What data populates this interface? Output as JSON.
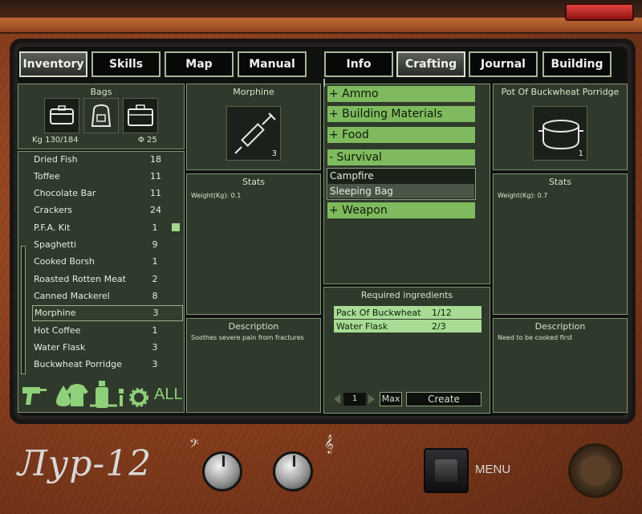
{
  "tabs": [
    {
      "label": "Inventory",
      "active": true
    },
    {
      "label": "Skills"
    },
    {
      "label": "Map"
    },
    {
      "label": "Manual"
    },
    {
      "label": "Info"
    },
    {
      "label": "Crafting",
      "active": true
    },
    {
      "label": "Journal"
    },
    {
      "label": "Building"
    }
  ],
  "bags": {
    "title": "Bags",
    "icons": [
      "box-icon",
      "backpack-icon",
      "suitcase-icon"
    ],
    "weight": "Kg 130/184",
    "count": "Φ 25"
  },
  "inventory": [
    {
      "name": "Dried Fish",
      "qty": "18"
    },
    {
      "name": "Toffee",
      "qty": "11"
    },
    {
      "name": "Chocolate Bar",
      "qty": "11"
    },
    {
      "name": "Crackers",
      "qty": "24"
    },
    {
      "name": "P.F.A. Kit",
      "qty": "1"
    },
    {
      "name": "Spaghetti",
      "qty": "9"
    },
    {
      "name": "Cooked Borsh",
      "qty": "1"
    },
    {
      "name": "Roasted Rotten Meat",
      "qty": "2"
    },
    {
      "name": "Canned Mackerel",
      "qty": "8"
    },
    {
      "name": "Morphine",
      "qty": "3"
    },
    {
      "name": "Hot Coffee",
      "qty": "1"
    },
    {
      "name": "Water Flask",
      "qty": "3"
    },
    {
      "name": "Buckwheat Porridge",
      "qty": "3"
    }
  ],
  "filter": {
    "all_label": "ALL",
    "icons": [
      "drill-icon",
      "drop-icon",
      "shirt-icon",
      "bottle-icon",
      "gear-icon",
      "syringe-icon",
      "tool-icon"
    ]
  },
  "selected_item": {
    "name": "Morphine",
    "count": "3",
    "stats_title": "Stats",
    "stats": "Weight(Kg): 0.1",
    "description_title": "Description",
    "description": "Soothes severe pain from fractures"
  },
  "crafting": {
    "categories": [
      {
        "label": "+ Ammo"
      },
      {
        "label": "+ Building Materials"
      },
      {
        "label": "+ Food"
      },
      {
        "label": "- Survival"
      },
      {
        "label": "+ Weapon"
      }
    ],
    "recipes": [
      "Campfire",
      "Sleeping Bag"
    ],
    "ingredients_title": "Required ingredients",
    "ingredients": [
      {
        "name": "Pack Of Buckwheat",
        "qty": "1/12"
      },
      {
        "name": "Water Flask",
        "qty": "2/3"
      }
    ],
    "amount": "1",
    "max_label": "Max",
    "create_label": "Create"
  },
  "result_item": {
    "name": "Pot Of Buckwheat Porridge",
    "count": "1",
    "stats_title": "Stats",
    "stats": "Weight(Kg): 0.7",
    "description_title": "Description",
    "description": "Need to be cooked first"
  },
  "device": {
    "logo": "Лур-12",
    "menu_label": "MENU"
  },
  "colors": {
    "category_bg": "#7fbb5e",
    "ingredient_bg": "#a8dc95",
    "panel_bg": "#2f3a2c",
    "casing": "#8a3f1e"
  }
}
